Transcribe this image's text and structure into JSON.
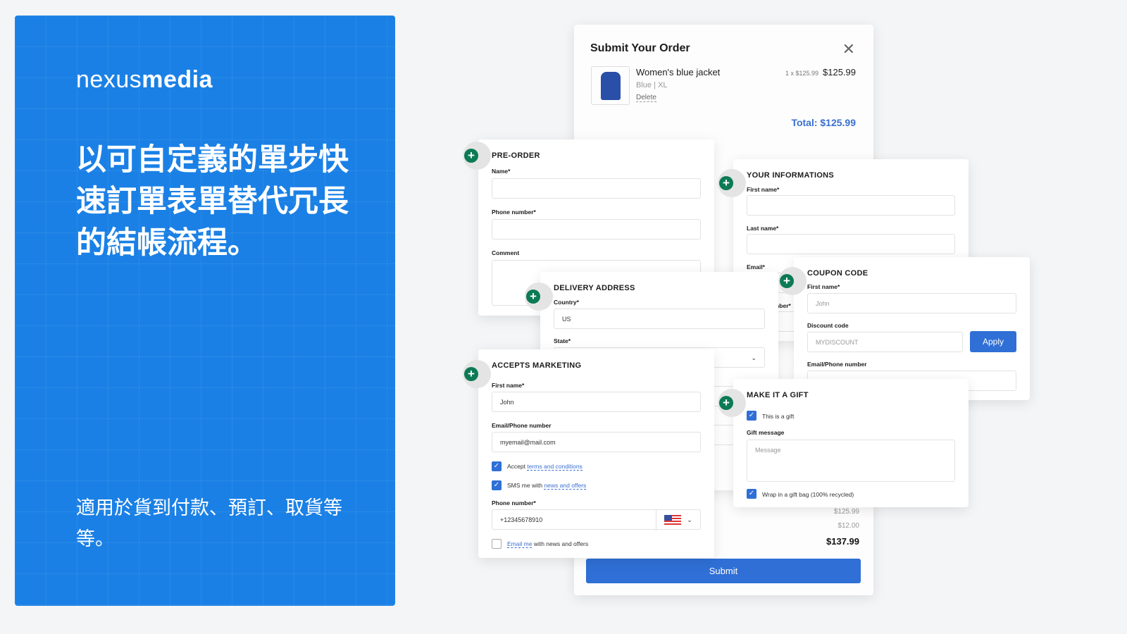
{
  "promo": {
    "logo_light": "nexus",
    "logo_bold": "media",
    "headline": "以可自定義的單步快速訂單表單替代冗長的結帳流程。",
    "subtext": "適用於貨到付款、預訂、取貨等等。"
  },
  "modal": {
    "title": "Submit Your Order",
    "product": {
      "name": "Women's blue jacket",
      "color": "Blue",
      "size": "XL",
      "delete": "Delete",
      "qty": "1 x $125.99",
      "price": "$125.99"
    },
    "total": "Total: $125.99",
    "subtotal": "$125.99",
    "shipping": "$12.00",
    "grand_total": "$137.99",
    "submit": "Submit"
  },
  "preorder": {
    "title": "PRE-ORDER",
    "name_label": "Name*",
    "phone_label": "Phone number*",
    "comment_label": "Comment"
  },
  "info": {
    "title": "YOUR INFORMATIONS",
    "first_label": "First name*",
    "last_label": "Last name*",
    "email_label": "Email*",
    "phone_label": "Phone number*"
  },
  "delivery": {
    "title": "DELIVERY ADDRESS",
    "country_label": "Country*",
    "country": "US",
    "state_label": "State*"
  },
  "coupon": {
    "title": "COUPON CODE",
    "first_label": "First name*",
    "first_ph": "John",
    "discount_label": "Discount code",
    "discount_ph": "MYDISCOUNT",
    "apply": "Apply",
    "contact_label": "Email/Phone number"
  },
  "marketing": {
    "title": "ACCEPTS MARKETING",
    "first_label": "First name*",
    "first": "John",
    "contact_label": "Email/Phone number",
    "contact": "myemail@mail.com",
    "accept": "Accept",
    "terms": "terms and conditions",
    "sms": "SMS me with",
    "news": "news and offers",
    "phone_label": "Phone number*",
    "phone": "+12345678910",
    "email_me": "Email me",
    "email_rest": "with news and offers",
    "accept_checked": true,
    "sms_checked": true,
    "email_checked": false
  },
  "gift": {
    "title": "MAKE IT A GIFT",
    "is_gift": "This is a gift",
    "msg_label": "Gift message",
    "msg_ph": "Message",
    "wrap": "Wrap in a gift bag (100% recycled)",
    "is_gift_checked": true,
    "wrap_checked": true
  },
  "colors": {
    "brand": "#1a80e5",
    "accent": "#2f6fd6",
    "plus": "#0c7a55"
  }
}
